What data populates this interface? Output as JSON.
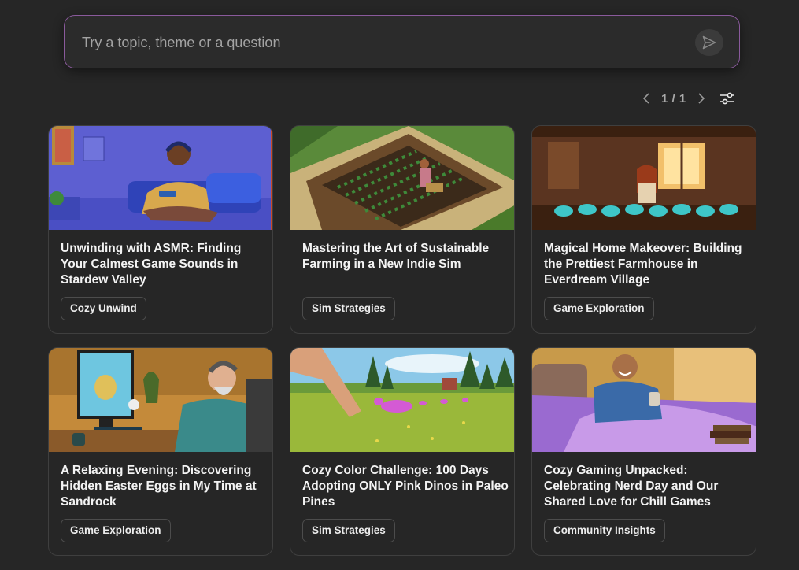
{
  "search": {
    "placeholder": "Try a topic, theme or a question",
    "value": ""
  },
  "pagination": {
    "label": "1 / 1"
  },
  "cards": [
    {
      "title": "Unwinding with ASMR: Finding Your Calmest Game Sounds in Stardew Valley",
      "tag": "Cozy Unwind"
    },
    {
      "title": "Mastering the Art of Sustainable Farming in a New Indie Sim",
      "tag": "Sim Strategies"
    },
    {
      "title": "Magical Home Makeover: Building the Prettiest Farmhouse in Everdream Village",
      "tag": "Game Exploration"
    },
    {
      "title": "A Relaxing Evening: Discovering Hidden Easter Eggs in My Time at Sandrock",
      "tag": "Game Exploration"
    },
    {
      "title": "Cozy Color Challenge: 100 Days Adopting ONLY Pink Dinos in Paleo Pines",
      "tag": "Sim Strategies"
    },
    {
      "title": "Cozy Gaming Unpacked: Celebrating Nerd Day and Our Shared Love for Chill Games",
      "tag": "Community Insights"
    }
  ]
}
